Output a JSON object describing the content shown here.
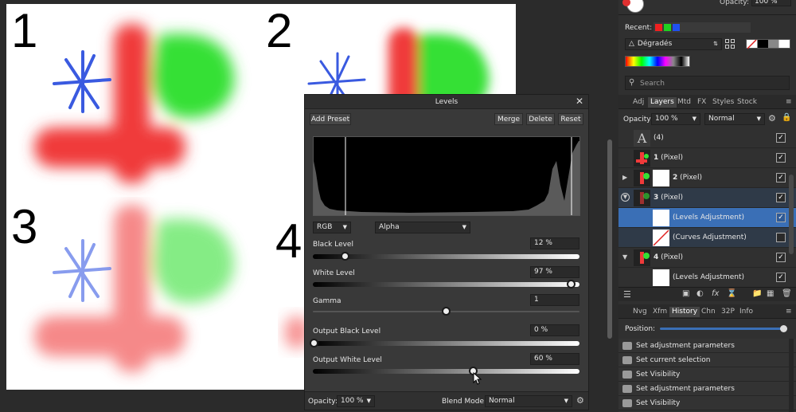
{
  "canvas": {
    "quadrant_numbers": [
      "1",
      "2",
      "3",
      "4"
    ]
  },
  "colors": {
    "ui_bg": "#2b2b2b",
    "panel_bg": "#303030",
    "accent": "#3a6fb6",
    "brush_red": "#f03a3a",
    "brush_green": "#34e034",
    "brush_blue": "#3a5ae0"
  },
  "top_panel": {
    "opacity_label": "Opacity:",
    "opacity_value": "100 %",
    "recent_label": "Recent:",
    "gradient_select": "Dégradés",
    "search_placeholder": "Search"
  },
  "panel_tabs": [
    "Adj",
    "Layers",
    "Mtd",
    "FX",
    "Styles",
    "Stock"
  ],
  "layers_toolbar": {
    "opacity_label": "Opacity:",
    "opacity_value": "100 %",
    "blend_mode": "Normal"
  },
  "layers": [
    {
      "name": "(4)",
      "bold": false,
      "checked": true
    },
    {
      "name_bold": "1",
      "name_rest": " (Pixel)",
      "checked": true
    },
    {
      "name_bold": "2",
      "name_rest": " (Pixel)",
      "checked": true
    },
    {
      "name_bold": "3",
      "name_rest": " (Pixel)",
      "checked": true
    },
    {
      "name": "(Levels Adjustment)",
      "checked": true,
      "selected": true
    },
    {
      "name": "(Curves Adjustment)",
      "checked": false
    },
    {
      "name_bold": "4",
      "name_rest": " (Pixel)",
      "checked": true
    },
    {
      "name": "(Levels Adjustment)",
      "checked": true
    }
  ],
  "history_tabs": [
    "Nvg",
    "Xfm",
    "History",
    "Chn",
    "32P",
    "Info"
  ],
  "history": {
    "position_label": "Position:",
    "position_fraction": 0.97,
    "items": [
      "Set adjustment parameters",
      "Set current selection",
      "Set Visibility",
      "Set adjustment parameters",
      "Set Visibility"
    ]
  },
  "levels": {
    "title": "Levels",
    "add_preset": "Add Preset",
    "merge": "Merge",
    "delete": "Delete",
    "reset": "Reset",
    "channel": "RGB",
    "alpha": "Alpha",
    "black_level_label": "Black Level",
    "black_level_value": "12 %",
    "black_level_fraction": 0.12,
    "white_level_label": "White Level",
    "white_level_value": "97 %",
    "white_level_fraction": 0.97,
    "gamma_label": "Gamma",
    "gamma_value": "1",
    "gamma_fraction": 0.5,
    "output_black_label": "Output Black Level",
    "output_black_value": "0 %",
    "output_black_fraction": 0.0,
    "output_white_label": "Output White Level",
    "output_white_value": "60 %",
    "output_white_fraction": 0.6,
    "footer_opacity_label": "Opacity:",
    "footer_opacity_value": "100 %",
    "blend_mode_label": "Blend Mode:",
    "blend_mode_value": "Normal"
  }
}
